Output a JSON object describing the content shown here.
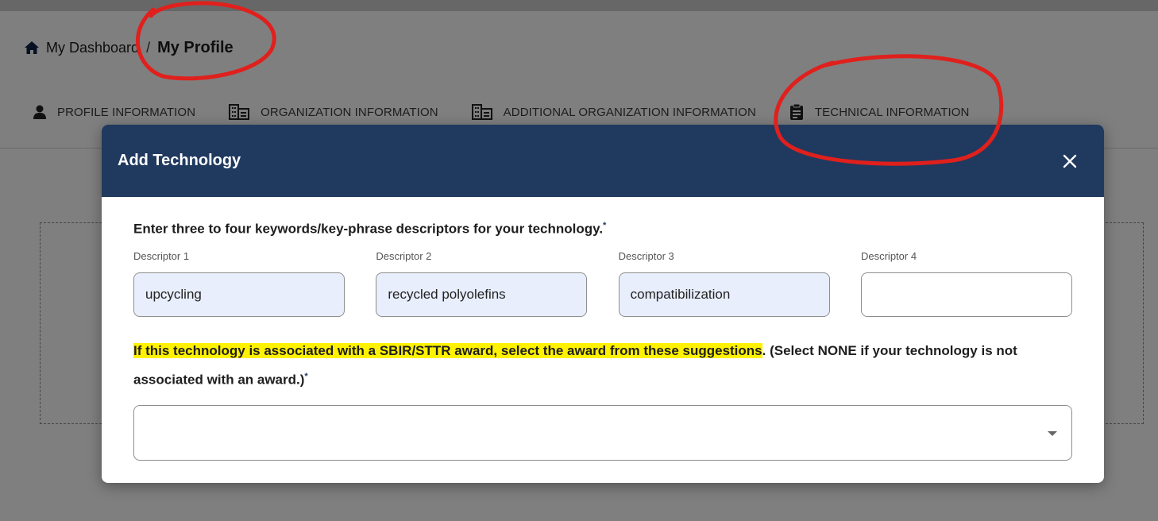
{
  "breadcrumb": {
    "home_label": "My Dashboard",
    "separator": "/",
    "current": "My Profile"
  },
  "tabs": [
    {
      "label": "PROFILE INFORMATION",
      "icon": "person-icon"
    },
    {
      "label": "ORGANIZATION INFORMATION",
      "icon": "building-icon"
    },
    {
      "label": "ADDITIONAL ORGANIZATION INFORMATION",
      "icon": "building-icon"
    },
    {
      "label": "TECHNICAL INFORMATION",
      "icon": "clipboard-icon"
    }
  ],
  "modal": {
    "title": "Add Technology",
    "instruction": "Enter three to four keywords/key-phrase descriptors for your technology.",
    "required_mark": "*",
    "descriptors": [
      {
        "label": "Descriptor 1",
        "value": "upcycling"
      },
      {
        "label": "Descriptor 2",
        "value": "recycled polyolefins"
      },
      {
        "label": "Descriptor 3",
        "value": "compatibilization"
      },
      {
        "label": "Descriptor 4",
        "value": ""
      }
    ],
    "award_highlighted": "If this technology is associated with a SBIR/STTR award, select the award from these suggestions",
    "award_period": ".",
    "award_rest": " (Select NONE if your technology is not associated with an award.)",
    "award_select_value": ""
  },
  "colors": {
    "header_bg": "#20395f",
    "highlight": "#fff200",
    "annotation": "#e0201c",
    "filled_input_bg": "#e8eefb"
  }
}
